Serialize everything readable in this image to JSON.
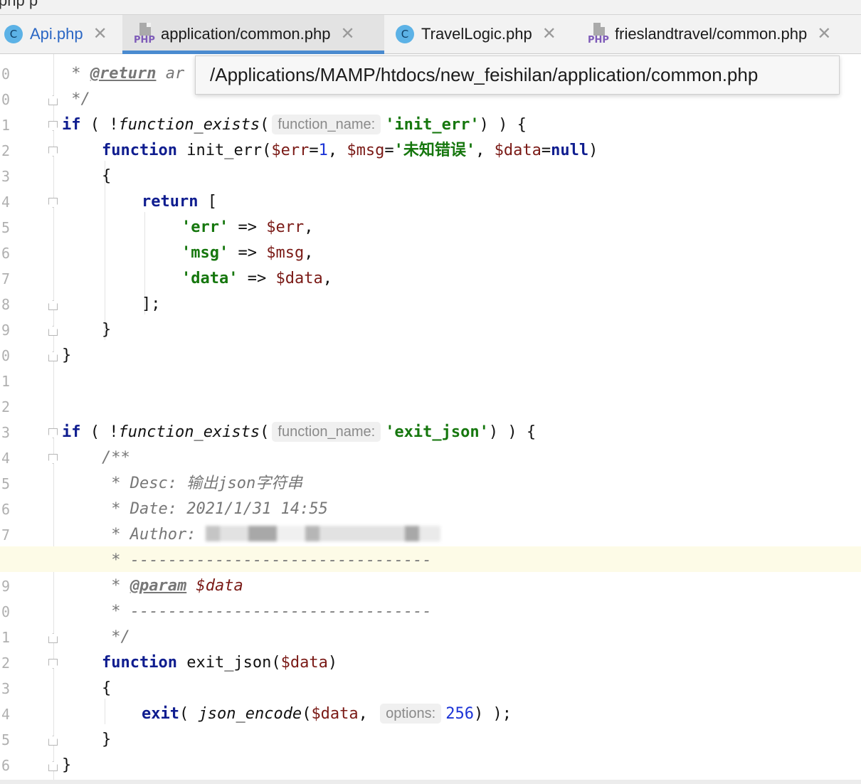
{
  "tabs": [
    {
      "label": "Api.php",
      "icon": "class-icon",
      "active": false
    },
    {
      "label": "application/common.php",
      "icon": "php-file-icon",
      "active": true
    },
    {
      "label": "TravelLogic.php",
      "icon": "class-icon",
      "active": false
    },
    {
      "label": "frieslandtravel/common.php",
      "icon": "php-file-icon",
      "active": false
    }
  ],
  "icons": {
    "class_letter": "C",
    "php_label": "PHP",
    "close": "✕"
  },
  "tooltip": {
    "path": "/Applications/MAMP/htdocs/new_feishilan/application/common.php"
  },
  "hints": {
    "function_name": "function_name:",
    "options": "options:"
  },
  "code": {
    "l1_star": " * ",
    "l1_return": "@return",
    "l1_tail": " ar",
    "l2": " */",
    "if": "if",
    "l3_open": " ( !",
    "function_exists": "function_exists",
    "paren": "(",
    "str_init_err": "'init_err'",
    "l3_close": ") ) {",
    "function": "function",
    "init_err_name": " init_err(",
    "err_var": "$err",
    "eq1": "=",
    "num1": "1",
    "comma": ", ",
    "msg_var": "$msg",
    "eq2": "=",
    "str_unknown": "'未知错误'",
    "data_var": "$data",
    "eq3": "=",
    "null": "null",
    "close_paren": ")",
    "brace_open": "{",
    "return": "return",
    "bracket": " [",
    "key_err": "'err'",
    "arrow": " => ",
    "val_err": "$err",
    "key_msg": "'msg'",
    "val_msg": "$msg",
    "key_data": "'data'",
    "val_data": "$data",
    "trail_comma": ",",
    "bracket_close": "];",
    "brace_close": "}",
    "str_exit_json": "'exit_json'",
    "doc_open": "/**",
    "desc": " * Desc: 输出json字符串",
    "date": " * Date: 2021/1/31 14:55",
    "author": " * Author: ",
    "sep": " * --------------------------------",
    "param_star": " * ",
    "param_tag": "@param",
    "param_var": " $data",
    "doc_close": " */",
    "exit_json_name": " exit_json(",
    "exit": "exit",
    "exit_open": "( ",
    "json_encode": "json_encode",
    "num256": "256",
    "exit_close": ") );"
  }
}
